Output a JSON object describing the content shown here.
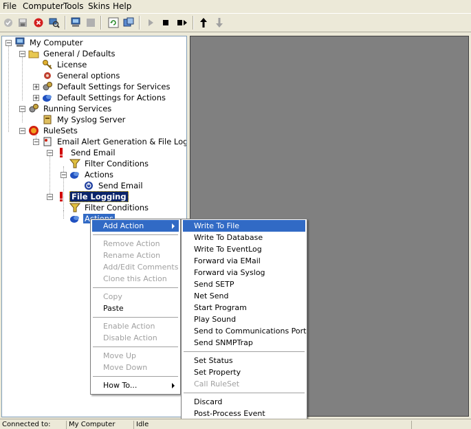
{
  "menubar": {
    "file": "File",
    "computer": "Computer",
    "tools": "Tools",
    "skins": "Skins",
    "help": "Help"
  },
  "tree": {
    "root": "My Computer",
    "general": "General / Defaults",
    "license": "License",
    "general_options": "General options",
    "default_services": "Default Settings for Services",
    "default_actions": "Default Settings for Actions",
    "running": "Running Services",
    "syslog": "My Syslog Server",
    "rulesets": "RuleSets",
    "ruleset1": "Email Alert Generation & File Logging",
    "rule_send_email": "Send Email",
    "filter1": "Filter Conditions",
    "actions1": "Actions",
    "action_send_email": "Send Email",
    "rule_file_logging": "File Logging",
    "filter2": "Filter Conditions",
    "actions2": "Actions"
  },
  "context_menu": {
    "add_action": "Add Action",
    "remove_action": "Remove Action",
    "rename_action": "Rename Action",
    "add_edit_comments": "Add/Edit Comments",
    "clone_action": "Clone this Action",
    "copy": "Copy",
    "paste": "Paste",
    "enable_action": "Enable Action",
    "disable_action": "Disable Action",
    "move_up": "Move Up",
    "move_down": "Move Down",
    "how_to": "How To..."
  },
  "submenu": {
    "write_to_file": "Write To File",
    "write_to_database": "Write To Database",
    "write_to_eventlog": "Write To EventLog",
    "forward_email": "Forward via EMail",
    "forward_syslog": "Forward via Syslog",
    "send_setp": "Send SETP",
    "net_send": "Net Send",
    "start_program": "Start Program",
    "play_sound": "Play Sound",
    "send_comm_port": "Send to Communications Port",
    "send_snmptrap": "Send SNMPTrap",
    "set_status": "Set Status",
    "set_property": "Set Property",
    "call_ruleset": "Call RuleSet",
    "discard": "Discard",
    "post_process": "Post-Process Event"
  },
  "status": {
    "connected": "Connected to:",
    "computer": "My Computer",
    "state": "Idle"
  },
  "colors": {
    "selection": "#0a246a",
    "menu_highlight": "#316ac5",
    "panel_gray": "#808080"
  }
}
